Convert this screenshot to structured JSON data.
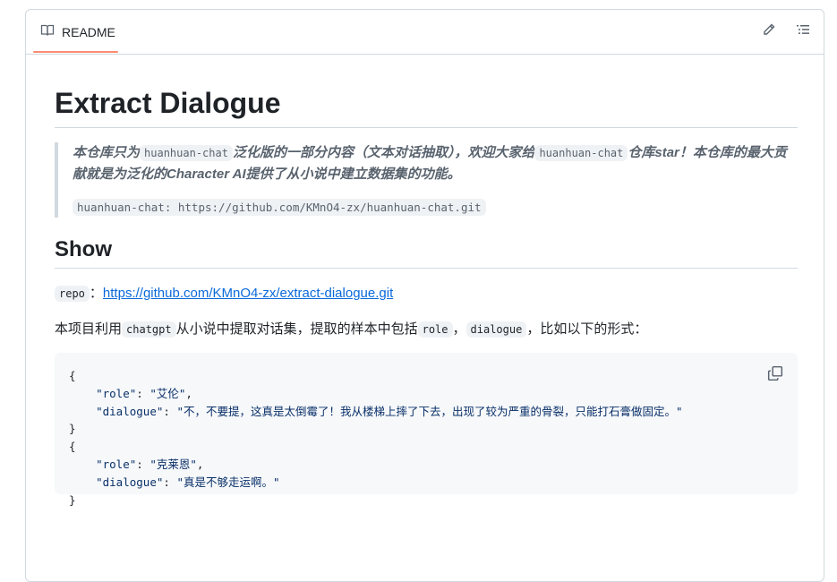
{
  "header": {
    "tab_label": "README",
    "edit_icon": "pencil-icon",
    "toc_icon": "list-icon",
    "accent": "#fd8c73"
  },
  "readme": {
    "title": "Extract Dialogue",
    "quote": {
      "part1": "本仓库只为",
      "code1": "huanhuan-chat",
      "part2": "泛化版的一部分内容（文本对话抽取），欢迎大家给",
      "code2": "huanhuan-chat",
      "part3": "仓库star！本仓库的最大贡献就是为泛化的Character AI提供了从小说中建立数据集的功能。",
      "code_line": "huanhuan-chat: https://github.com/KMnO4-zx/huanhuan-chat.git"
    },
    "show_heading": "Show",
    "repo": {
      "code": "repo",
      "sep": "：",
      "link": "https://github.com/KMnO4-zx/extract-dialogue.git"
    },
    "desc": {
      "part1": "本项目利用",
      "code1": "chatgpt",
      "part2": "从小说中提取对话集，提取的样本中包括",
      "code2": "role",
      "part3": "，",
      "code3": "dialogue",
      "part4": "，比如以下的形式："
    },
    "code_block": {
      "copy_icon": "copy-icon",
      "items": [
        {
          "key_role": "\"role\"",
          "role": "\"艾伦\"",
          "key_dialogue": "\"dialogue\"",
          "dialogue": "\"不，不要提，这真是太倒霉了！我从楼梯上摔了下去，出现了较为严重的骨裂，只能打石膏做固定。\""
        },
        {
          "key_role": "\"role\"",
          "role": "\"克莱恩\"",
          "key_dialogue": "\"dialogue\"",
          "dialogue": "\"真是不够走运啊。\""
        }
      ]
    }
  }
}
